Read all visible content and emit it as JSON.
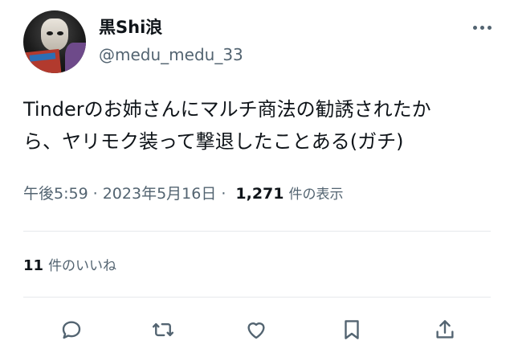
{
  "tweet": {
    "display_name": "黒Shi浪",
    "handle": "@medu_medu_33",
    "text_lines": [
      "Tinderのお姉さんにマルチ商法の勧誘されたか",
      "ら、ヤリモク装って撃退したことある(ガチ)"
    ],
    "time": "午後5:59",
    "date": "2023年5月16日",
    "separator": "·",
    "views_count": "1,271",
    "views_label": "件の表示",
    "likes_count": "11",
    "likes_label": "件のいいね"
  },
  "icons": {
    "more": "more-horizontal-icon",
    "reply": "reply-icon",
    "retweet": "retweet-icon",
    "like": "heart-icon",
    "bookmark": "bookmark-icon",
    "share": "share-icon"
  },
  "colors": {
    "text_primary": "#0f1419",
    "text_secondary": "#536471",
    "divider": "#e6e9ec"
  }
}
